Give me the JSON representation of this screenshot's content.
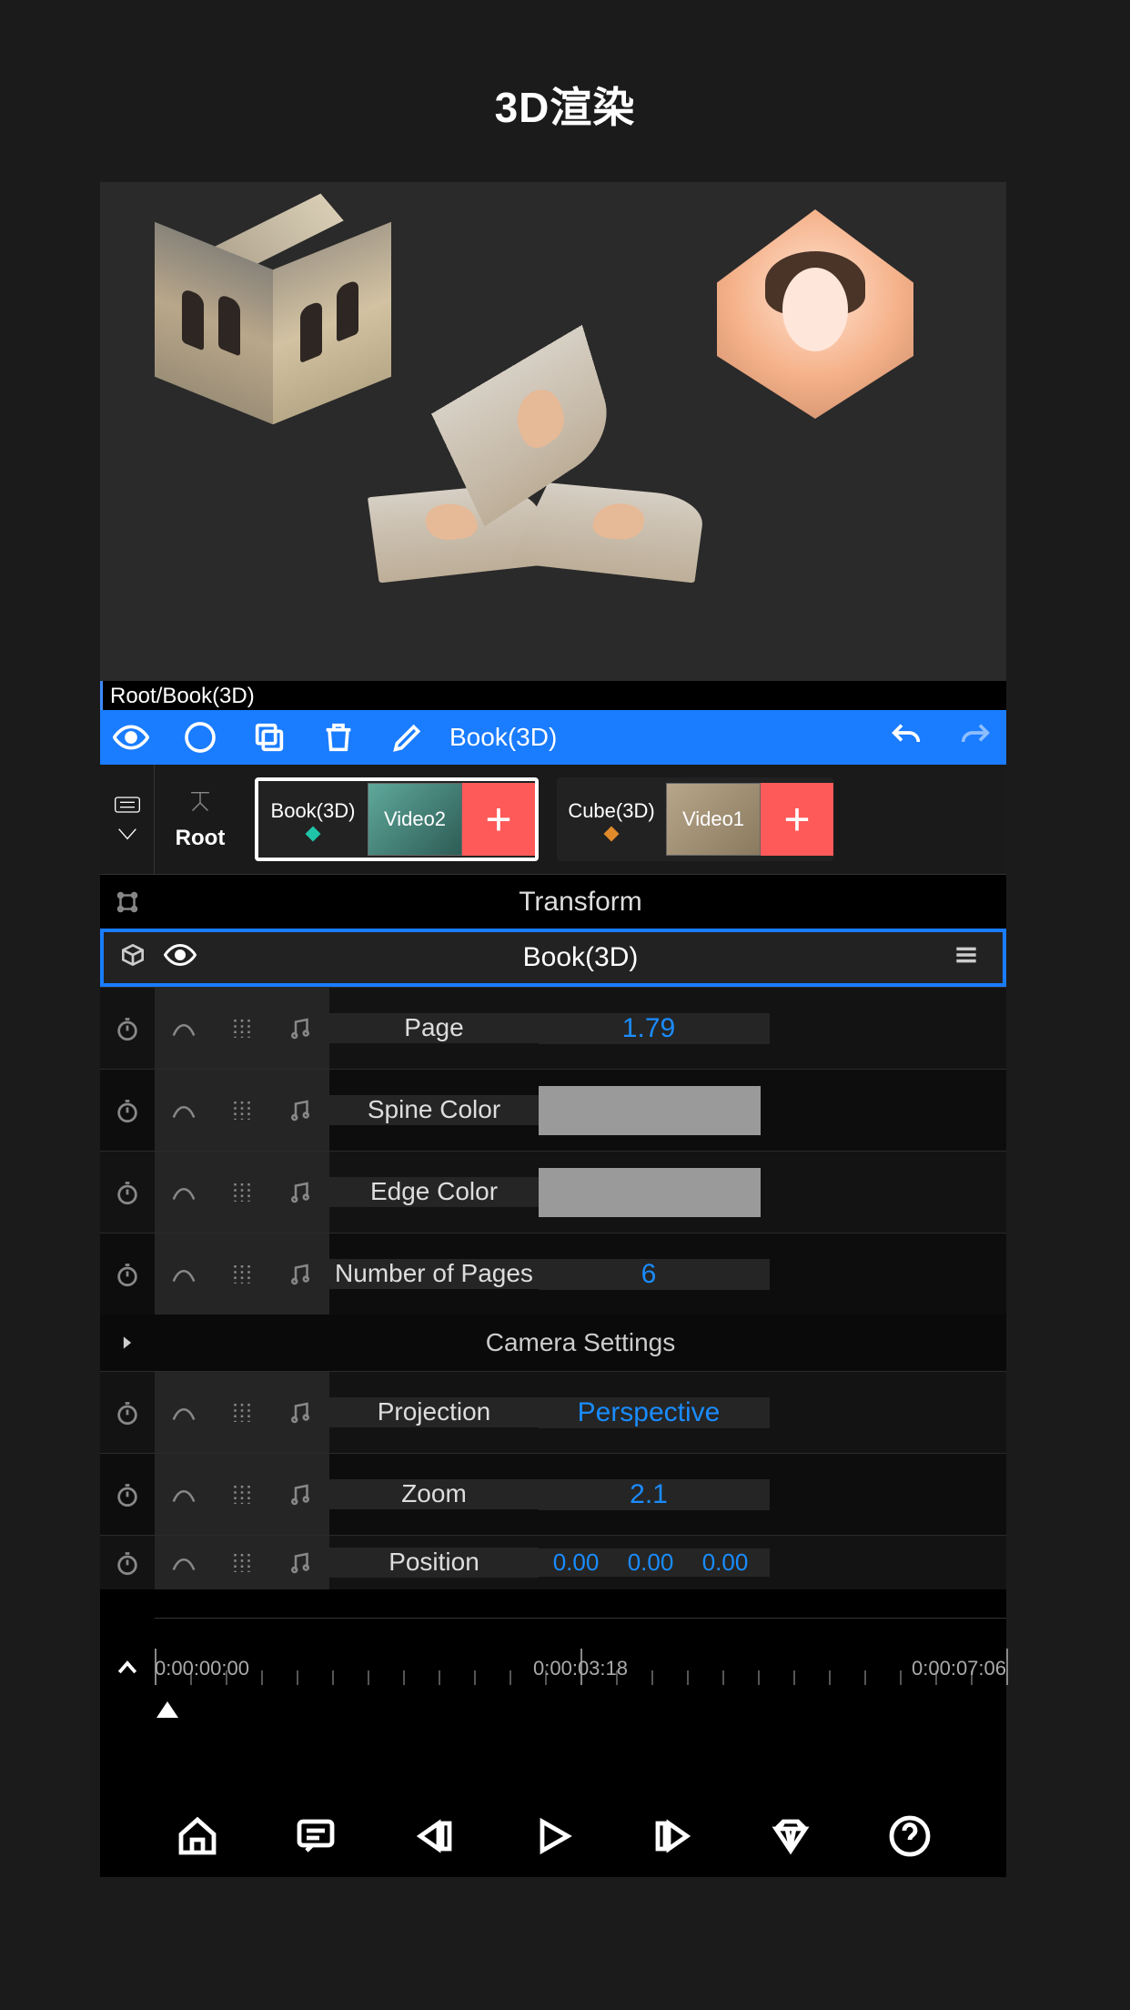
{
  "page_title": "3D渲染",
  "breadcrumb": "Root/Book(3D)",
  "toolbar": {
    "edit_label": "Book(3D)"
  },
  "layer_strip": {
    "root_label": "Root",
    "items": [
      {
        "label": "Book(3D)",
        "thumb_text": "Video2",
        "diamond_color": "#1fc4a8"
      },
      {
        "label": "Cube(3D)",
        "thumb_text": "Video1",
        "diamond_color": "#e08a2a"
      }
    ]
  },
  "transform_section": "Transform",
  "object_header": {
    "title": "Book(3D)"
  },
  "properties": {
    "page": {
      "label": "Page",
      "value": "1.79"
    },
    "spine_color": {
      "label": "Spine Color",
      "color": "#9a9a9a"
    },
    "edge_color": {
      "label": "Edge Color",
      "color": "#9a9a9a"
    },
    "num_pages": {
      "label": "Number of Pages",
      "value": "6"
    },
    "camera_section": "Camera Settings",
    "projection": {
      "label": "Projection",
      "value": "Perspective"
    },
    "zoom": {
      "label": "Zoom",
      "value": "2.1"
    },
    "position": {
      "label": "Position",
      "x": "0.00",
      "y": "0.00",
      "z": "0.00"
    }
  },
  "timeline": {
    "labels": [
      "0:00:00:00",
      "0:00:03:18",
      "0:00:07:06"
    ]
  }
}
